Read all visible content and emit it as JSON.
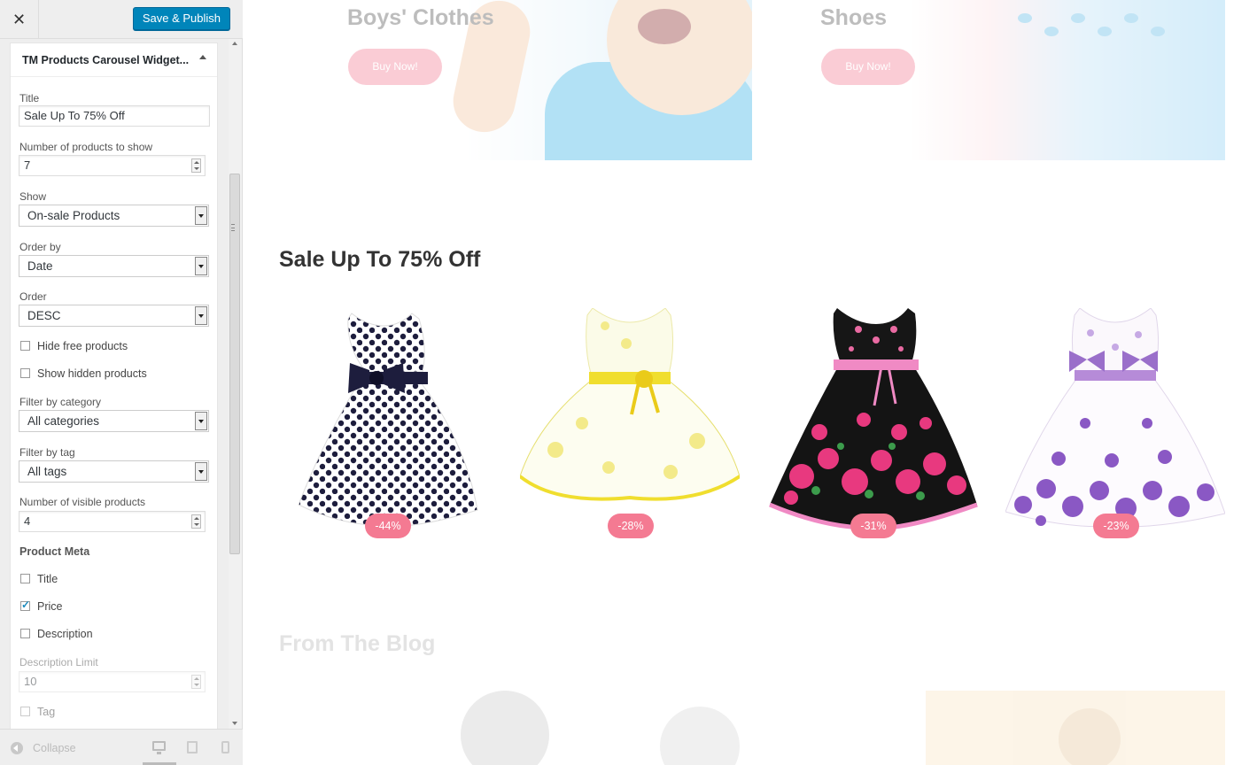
{
  "sidebar": {
    "close_label": "✕",
    "publish_label": "Save & Publish",
    "widget_title": "TM Products Carousel Widget...",
    "fields": {
      "title_label": "Title",
      "title_value": "Sale Up To 75% Off",
      "num_products_label": "Number of products to show",
      "num_products_value": "7",
      "show_label": "Show",
      "show_value": "On-sale Products",
      "orderby_label": "Order by",
      "orderby_value": "Date",
      "order_label": "Order",
      "order_value": "DESC",
      "hide_free_label": "Hide free products",
      "show_hidden_label": "Show hidden products",
      "filter_cat_label": "Filter by category",
      "filter_cat_value": "All categories",
      "filter_tag_label": "Filter by tag",
      "filter_tag_value": "All tags",
      "num_visible_label": "Number of visible products",
      "num_visible_value": "4",
      "product_meta_label": "Product Meta",
      "meta_title_label": "Title",
      "meta_price_label": "Price",
      "meta_desc_label": "Description",
      "desc_limit_label": "Description Limit",
      "desc_limit_value": "10",
      "meta_tag_label": "Tag"
    },
    "footer": {
      "collapse_label": "Collapse"
    }
  },
  "preview": {
    "banners": [
      {
        "title": "Boys' Clothes",
        "button": "Buy Now!"
      },
      {
        "title": "Shoes",
        "button": "Buy Now!"
      }
    ],
    "sale_title": "Sale Up To 75% Off",
    "products": [
      {
        "badge": "-44%"
      },
      {
        "badge": "-28%"
      },
      {
        "badge": "-31%"
      },
      {
        "badge": "-23%"
      }
    ],
    "blog_title": "From The Blog"
  },
  "colors": {
    "accent": "#0085ba",
    "badge": "#f47a92"
  }
}
